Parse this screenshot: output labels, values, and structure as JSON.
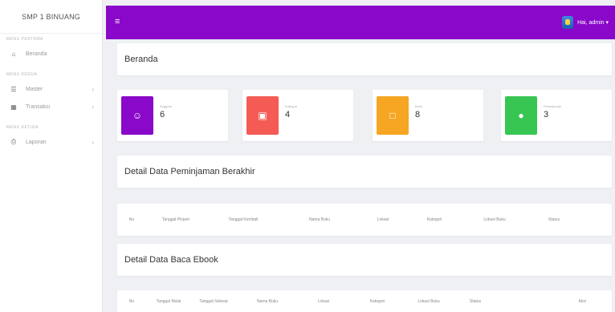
{
  "sidebar": {
    "brand": "SMP 1 BINUANG",
    "sections": [
      {
        "heading": "MENU PERTAMA",
        "items": [
          {
            "icon": "home-icon",
            "label": "Beranda",
            "has_submenu": false
          }
        ]
      },
      {
        "heading": "MENU KEDUA",
        "items": [
          {
            "icon": "list-icon",
            "label": "Master",
            "has_submenu": true
          },
          {
            "icon": "book-icon",
            "label": "Transaksi",
            "has_submenu": true
          }
        ]
      },
      {
        "heading": "MENU KETIGA",
        "items": [
          {
            "icon": "print-icon",
            "label": "Laporan",
            "has_submenu": true
          }
        ]
      }
    ]
  },
  "topbar": {
    "user_label": "Hai, admin ▾",
    "color": "#8a08c9"
  },
  "page_title": "Beranda",
  "cards": [
    {
      "caption": "Anggota",
      "value": "6",
      "color": "#8a08c9",
      "icon": "user-icon"
    },
    {
      "caption": "Kategori",
      "value": "4",
      "color": "#f45b55",
      "icon": "card-icon"
    },
    {
      "caption": "Buku",
      "value": "8",
      "color": "#f6a623",
      "icon": "file-icon"
    },
    {
      "caption": "Peminjaman",
      "value": "3",
      "color": "#38c653",
      "icon": "circle-icon"
    }
  ],
  "peminjaman": {
    "title": "Detail Data Peminjaman Berakhir",
    "columns": [
      "No",
      "Tanggal Pinjam",
      "Tanggal Kembali",
      "Nama Buku",
      "Lokasi",
      "Kategori",
      "Lokasi Buku",
      "Status"
    ]
  },
  "ebook": {
    "title": "Detail Data Baca Ebook",
    "columns": [
      "No",
      "Tanggal Mulai",
      "Tanggal Selesai",
      "Nama Buku",
      "Lokasi",
      "Kategori",
      "Lokasi Buku",
      "Status",
      "Aksi"
    ]
  }
}
